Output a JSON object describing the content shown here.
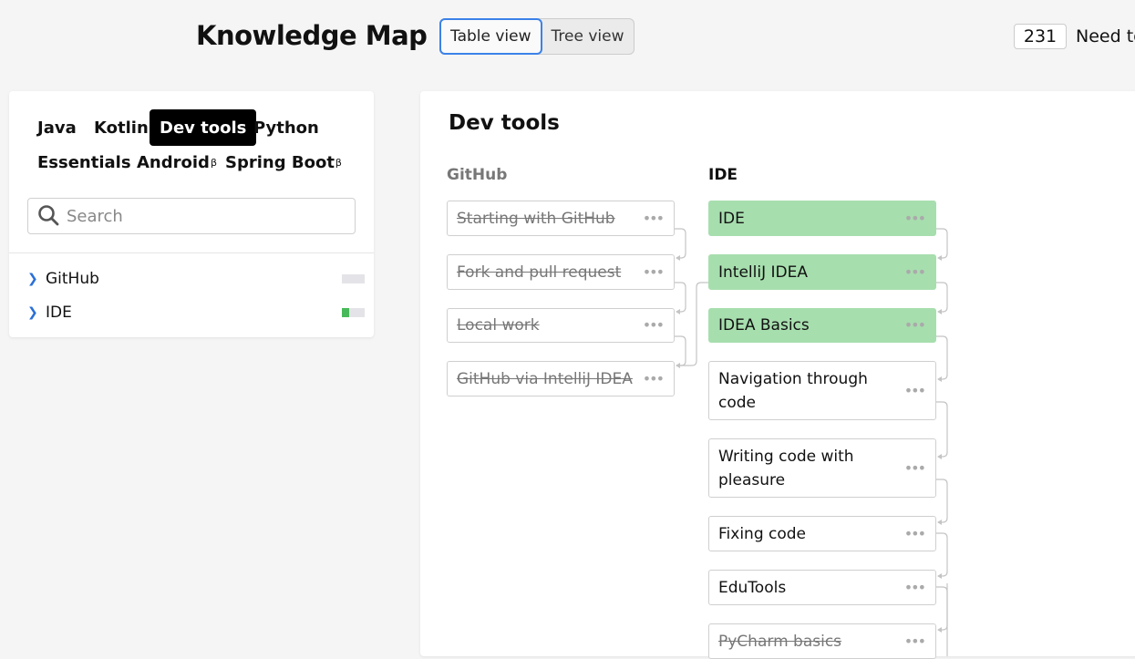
{
  "header": {
    "title": "Knowledge Map",
    "views": [
      "Table view",
      "Tree view"
    ],
    "active_view": "Table view",
    "count": "231",
    "need_text": "Need to"
  },
  "sidebar": {
    "tabs_row1": [
      "Java",
      "Kotlin",
      "Dev tools",
      "Python"
    ],
    "tabs_row2": [
      {
        "label": "Essentials",
        "beta": ""
      },
      {
        "label": "Android",
        "beta": "β"
      },
      {
        "label": "Spring Boot",
        "beta": "β"
      }
    ],
    "active_tab": "Dev tools",
    "search_placeholder": "Search",
    "topics": [
      {
        "label": "GitHub",
        "progress": 0
      },
      {
        "label": "IDE",
        "progress": 0.3
      }
    ]
  },
  "main": {
    "title": "Dev tools",
    "columns": [
      {
        "name": "GitHub",
        "items": [
          {
            "label": "Starting with GitHub",
            "state": "done"
          },
          {
            "label": "Fork and pull request",
            "state": "done"
          },
          {
            "label": "Local work",
            "state": "done"
          },
          {
            "label": "GitHub via IntelliJ IDEA",
            "state": "done"
          }
        ]
      },
      {
        "name": "IDE",
        "items": [
          {
            "label": "IDE",
            "state": "learned"
          },
          {
            "label": "IntelliJ IDEA",
            "state": "learned"
          },
          {
            "label": "IDEA Basics",
            "state": "learned"
          },
          {
            "label": "Navigation through code",
            "state": "todo"
          },
          {
            "label": "Writing code with pleasure",
            "state": "todo"
          },
          {
            "label": "Fixing code",
            "state": "todo"
          },
          {
            "label": "EduTools",
            "state": "todo"
          },
          {
            "label": "PyCharm basics",
            "state": "done"
          }
        ]
      }
    ],
    "more_glyph": "•••"
  },
  "colors": {
    "learned": "#a7deae",
    "accent": "#3b82e8",
    "progress": "#48b95a"
  }
}
